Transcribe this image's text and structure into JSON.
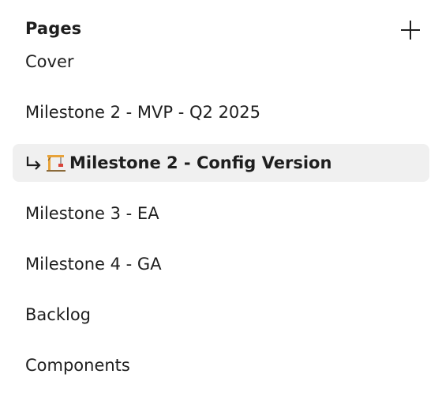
{
  "panel": {
    "title": "Pages",
    "add_icon": "plus-icon"
  },
  "pages": [
    {
      "label": "Cover",
      "selected": false
    },
    {
      "label": "Milestone 2 - MVP - Q2 2025",
      "selected": false
    },
    {
      "label": "Milestone 2 - Config Version",
      "selected": true,
      "nested_icon": "return-arrow-icon",
      "emoji_icon": "building-construction-icon"
    },
    {
      "label": "Milestone 3 - EA",
      "selected": false
    },
    {
      "label": "Milestone 4 - GA",
      "selected": false
    },
    {
      "label": "Backlog",
      "selected": false
    },
    {
      "label": "Components",
      "selected": false
    }
  ],
  "colors": {
    "text": "#1e1e1e",
    "selected_bg": "#f0f0f0",
    "background": "#ffffff"
  }
}
